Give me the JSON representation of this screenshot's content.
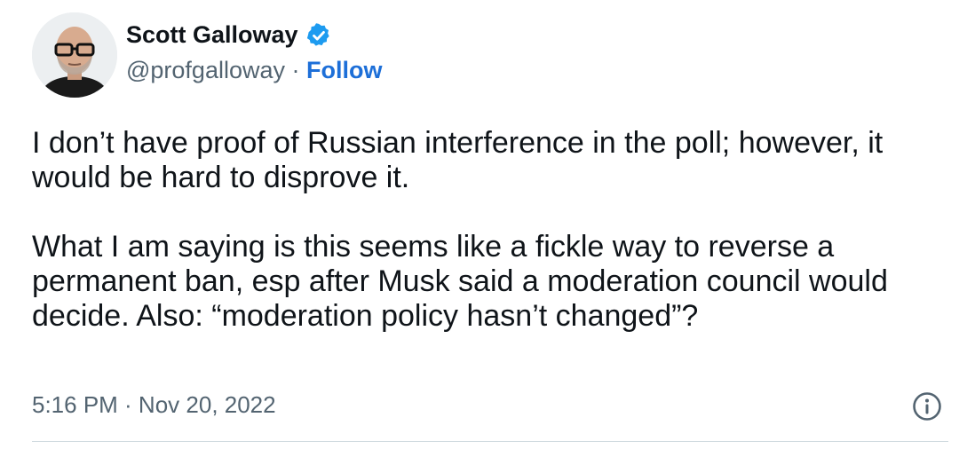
{
  "author": {
    "name": "Scott Galloway",
    "handle": "@profgalloway",
    "separator": " · ",
    "follow_label": "Follow",
    "verified_icon": "verified-badge-icon",
    "avatar_icon": "profile-photo"
  },
  "tweet": {
    "paragraphs": [
      "I don’t have proof of Russian interference in the poll; however, it would be hard to disprove it.",
      "What I am saying is this seems like a fickle way to reverse a permanent ban, esp after Musk said a moderation council would decide. Also: “moderation policy hasn’t changed”?"
    ],
    "timestamp": "5:16 PM · Nov 20, 2022"
  },
  "icons": {
    "info": "info-icon"
  },
  "colors": {
    "text": "#0f1419",
    "secondary": "#536471",
    "link": "#1d6fd8",
    "verified": "#1d9bf0",
    "divider": "#cfd9de"
  }
}
